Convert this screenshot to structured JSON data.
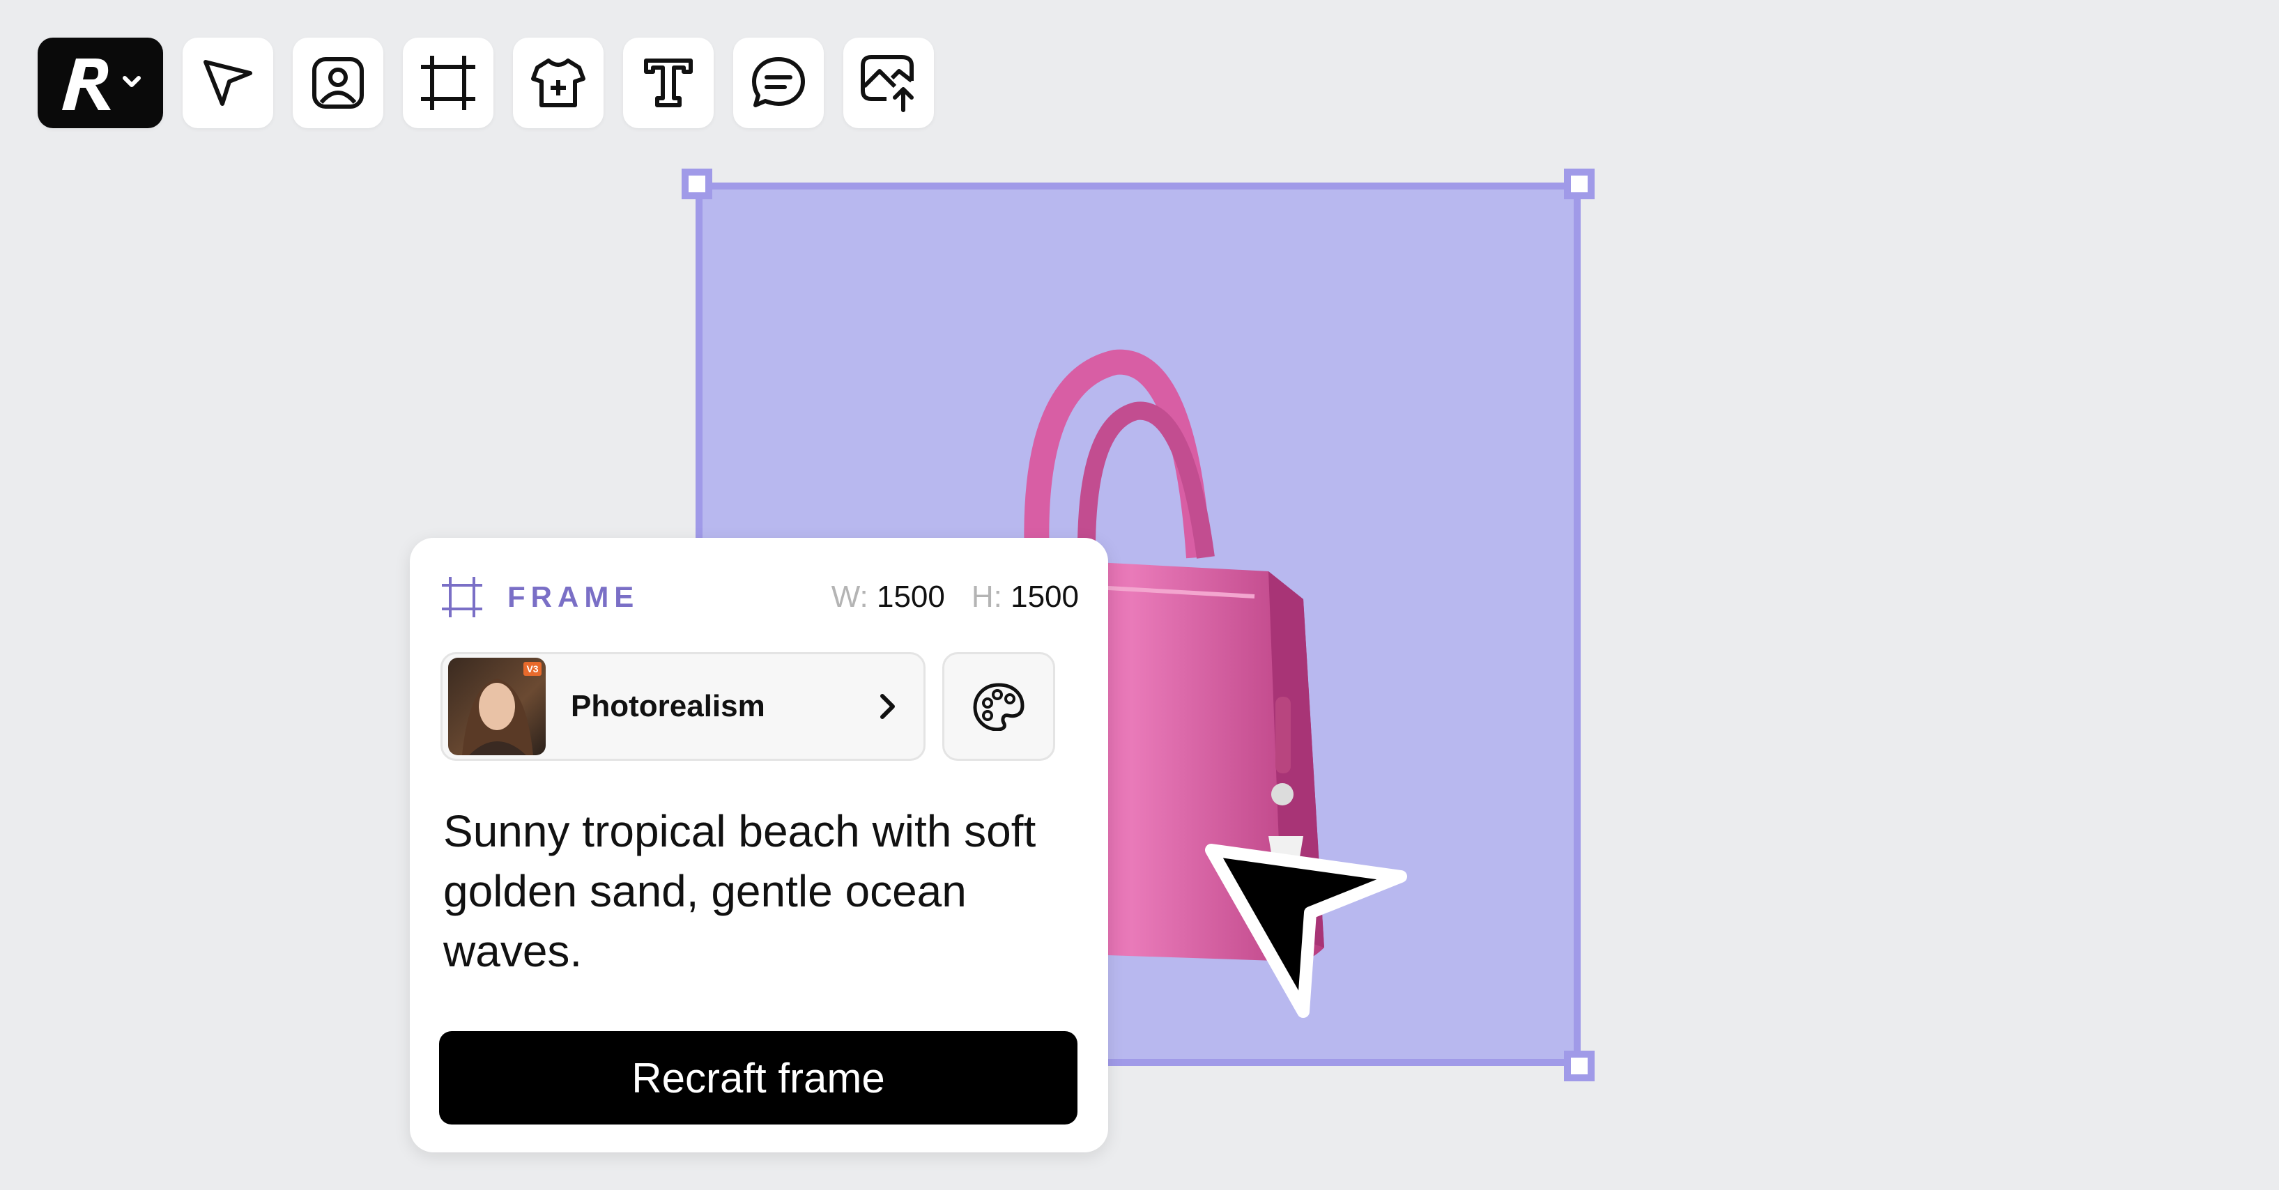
{
  "toolbar": {
    "tools": [
      {
        "name": "app-logo",
        "icon": "recraft-logo-icon"
      },
      {
        "name": "select-tool",
        "icon": "pointer-icon"
      },
      {
        "name": "image-tool",
        "icon": "portrait-image-icon"
      },
      {
        "name": "frame-tool",
        "icon": "frame-crop-icon"
      },
      {
        "name": "mockup-tool",
        "icon": "tshirt-plus-icon"
      },
      {
        "name": "text-tool",
        "icon": "text-t-icon"
      },
      {
        "name": "comment-tool",
        "icon": "chat-bubble-icon"
      },
      {
        "name": "upload-tool",
        "icon": "image-upload-icon"
      }
    ]
  },
  "panel": {
    "title": "FRAME",
    "width_label": "W:",
    "width_value": "1500",
    "height_label": "H:",
    "height_value": "1500",
    "style_name": "Photorealism",
    "style_badge": "V3",
    "prompt": "Sunny tropical beach with soft golden sand, gentle ocean waves.",
    "button_label": "Recraft frame"
  },
  "colors": {
    "frame_fill": "#b8b8ef",
    "frame_border": "#a09ae8",
    "accent_text": "#7a6fc6",
    "bag": "#e46fb1"
  }
}
